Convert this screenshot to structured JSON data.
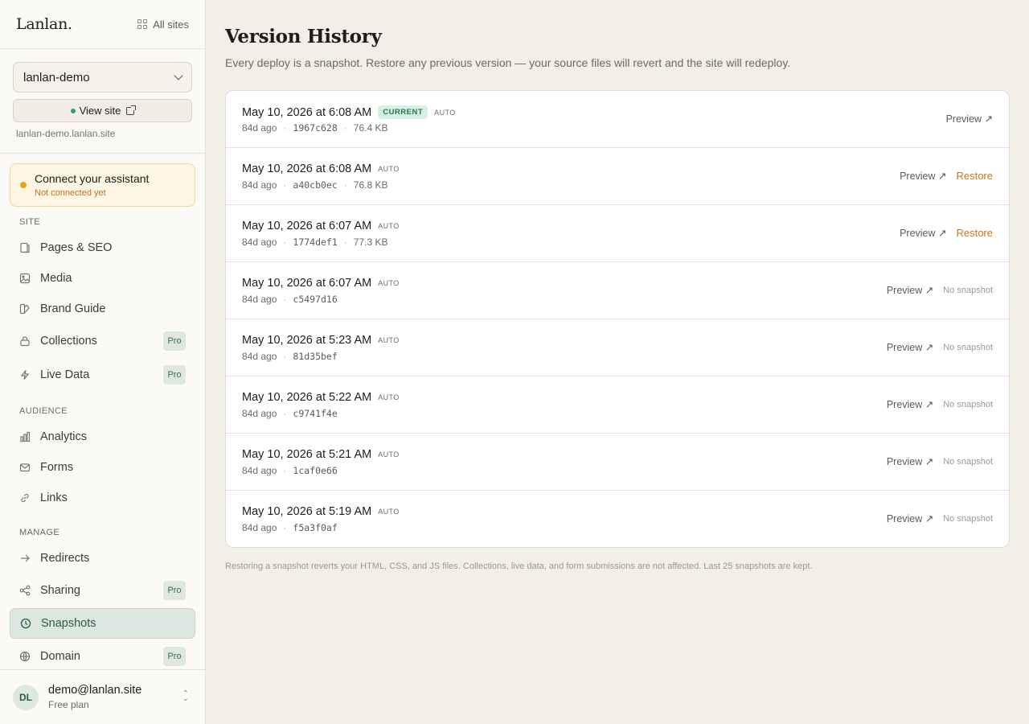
{
  "app": {
    "logo": "Lanlan.",
    "all_sites": "All sites"
  },
  "site": {
    "name": "lanlan-demo",
    "view_site": "View site",
    "url": "lanlan-demo.lanlan.site"
  },
  "assistant": {
    "title": "Connect your assistant",
    "status": "Not connected yet"
  },
  "nav": {
    "site_label": "SITE",
    "audience_label": "AUDIENCE",
    "manage_label": "MANAGE",
    "pro": "Pro",
    "items": {
      "pages": "Pages & SEO",
      "media": "Media",
      "brand": "Brand Guide",
      "collections": "Collections",
      "live_data": "Live Data",
      "analytics": "Analytics",
      "forms": "Forms",
      "links": "Links",
      "redirects": "Redirects",
      "sharing": "Sharing",
      "snapshots": "Snapshots",
      "domain": "Domain"
    }
  },
  "user": {
    "initials": "DL",
    "email": "demo@lanlan.site",
    "plan": "Free plan"
  },
  "page": {
    "title": "Version History",
    "subtitle": "Every deploy is a snapshot. Restore any previous version — your source files will revert and the site will redeploy.",
    "footer": "Restoring a snapshot reverts your HTML, CSS, and JS files. Collections, live data, and form submissions are not affected. Last 25 snapshots are kept."
  },
  "labels": {
    "current": "CURRENT",
    "auto": "AUTO",
    "preview": "Preview ↗",
    "restore": "Restore",
    "no_snapshot": "No snapshot"
  },
  "versions": [
    {
      "date": "May 10, 2026 at 6:08 AM",
      "current": true,
      "ago": "84d ago",
      "hash": "1967c628",
      "size": "76.4 KB",
      "action": "none"
    },
    {
      "date": "May 10, 2026 at 6:08 AM",
      "current": false,
      "ago": "84d ago",
      "hash": "a40cb0ec",
      "size": "76.8 KB",
      "action": "restore"
    },
    {
      "date": "May 10, 2026 at 6:07 AM",
      "current": false,
      "ago": "84d ago",
      "hash": "1774def1",
      "size": "77.3 KB",
      "action": "restore"
    },
    {
      "date": "May 10, 2026 at 6:07 AM",
      "current": false,
      "ago": "84d ago",
      "hash": "c5497d16",
      "size": "",
      "action": "nosnap"
    },
    {
      "date": "May 10, 2026 at 5:23 AM",
      "current": false,
      "ago": "84d ago",
      "hash": "81d35bef",
      "size": "",
      "action": "nosnap"
    },
    {
      "date": "May 10, 2026 at 5:22 AM",
      "current": false,
      "ago": "84d ago",
      "hash": "c9741f4e",
      "size": "",
      "action": "nosnap"
    },
    {
      "date": "May 10, 2026 at 5:21 AM",
      "current": false,
      "ago": "84d ago",
      "hash": "1caf0e66",
      "size": "",
      "action": "nosnap"
    },
    {
      "date": "May 10, 2026 at 5:19 AM",
      "current": false,
      "ago": "84d ago",
      "hash": "f5a3f0af",
      "size": "",
      "action": "nosnap"
    }
  ]
}
